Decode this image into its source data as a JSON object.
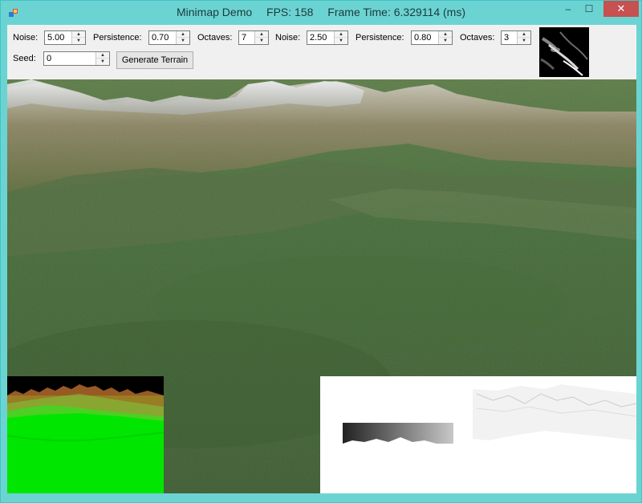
{
  "window": {
    "title_app": "Minimap Demo",
    "title_fps": "FPS: 158",
    "title_frame_time": "Frame Time: 6.329114 (ms)",
    "controls": {
      "minimize": "–",
      "maximize": "☐",
      "close": "✕"
    }
  },
  "controls": {
    "row1": [
      {
        "label": "Noise:",
        "value": "5.00"
      },
      {
        "label": "Persistence:",
        "value": "0.70"
      },
      {
        "label": "Octaves:",
        "value": "7"
      },
      {
        "label": "Noise:",
        "value": "2.50"
      },
      {
        "label": "Persistence:",
        "value": "0.80"
      },
      {
        "label": "Octaves:",
        "value": "3"
      }
    ],
    "seed": {
      "label": "Seed:",
      "value": "0"
    },
    "generate_label": "Generate Terrain"
  },
  "colors": {
    "titlebar": "#6cd3d3",
    "close_button": "#c75050",
    "toolbar": "#f0f0f0",
    "minimap_green": "#00e600",
    "terrain_grass": "#3f6334"
  },
  "icons": {
    "app": "app-icon",
    "spin_up": "up-arrow-icon",
    "spin_down": "down-arrow-icon"
  }
}
